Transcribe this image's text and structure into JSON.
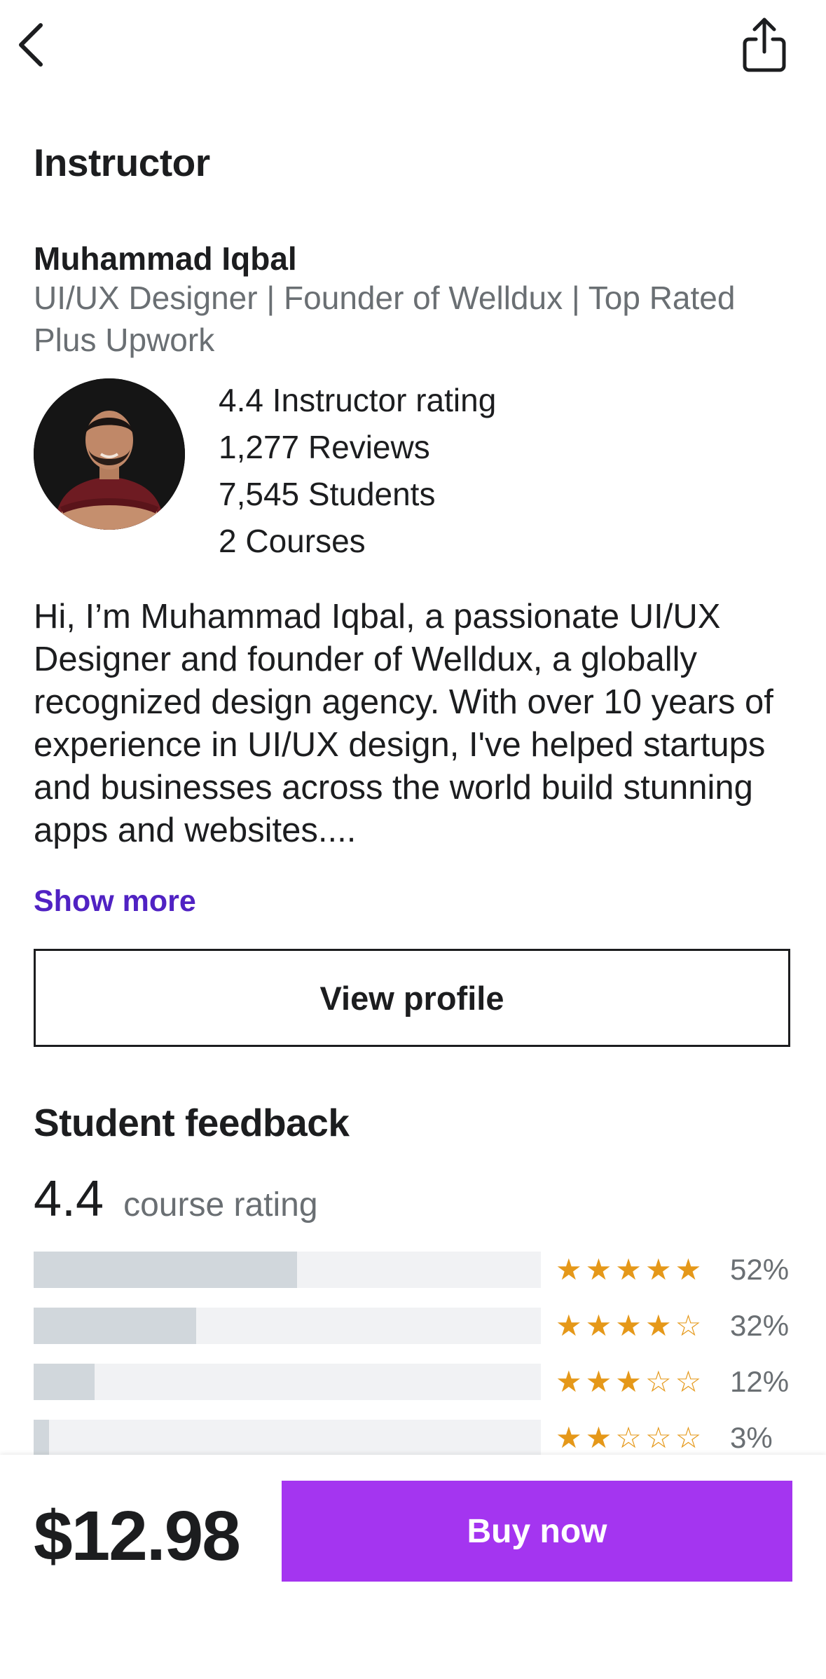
{
  "header": {
    "back_icon": "chevron-left-icon",
    "share_icon": "share-icon"
  },
  "instructor": {
    "section_title": "Instructor",
    "name": "Muhammad Iqbal",
    "headline": "UI/UX Designer | Founder of Welldux | Top Rated Plus Upwork",
    "stats": {
      "rating": "4.4 Instructor rating",
      "reviews": "1,277 Reviews",
      "students": "7,545 Students",
      "courses": "2 Courses"
    },
    "bio": "Hi, I’m Muhammad Iqbal, a passionate UI/UX Designer and founder of Welldux, a globally recognized design agency. With over 10 years of experience in UI/UX design, I've helped startups and businesses across the world build stunning apps and websites....",
    "show_more": "Show more",
    "view_profile": "View profile"
  },
  "feedback": {
    "section_title": "Student feedback",
    "rating": "4.4",
    "rating_label": "course rating",
    "star_color": "#e59819",
    "breakdown": [
      {
        "stars": 5,
        "stars_text": "★★★★★",
        "percent": 52,
        "percent_label": "52%"
      },
      {
        "stars": 4,
        "stars_text": "★★★★☆",
        "percent": 32,
        "percent_label": "32%"
      },
      {
        "stars": 3,
        "stars_text": "★★★☆☆",
        "percent": 12,
        "percent_label": "12%"
      },
      {
        "stars": 2,
        "stars_text": "★★☆☆☆",
        "percent": 3,
        "percent_label": "3%"
      }
    ]
  },
  "purchase": {
    "price": "$12.98",
    "buy_label": "Buy now",
    "accent": "#a435f0"
  }
}
